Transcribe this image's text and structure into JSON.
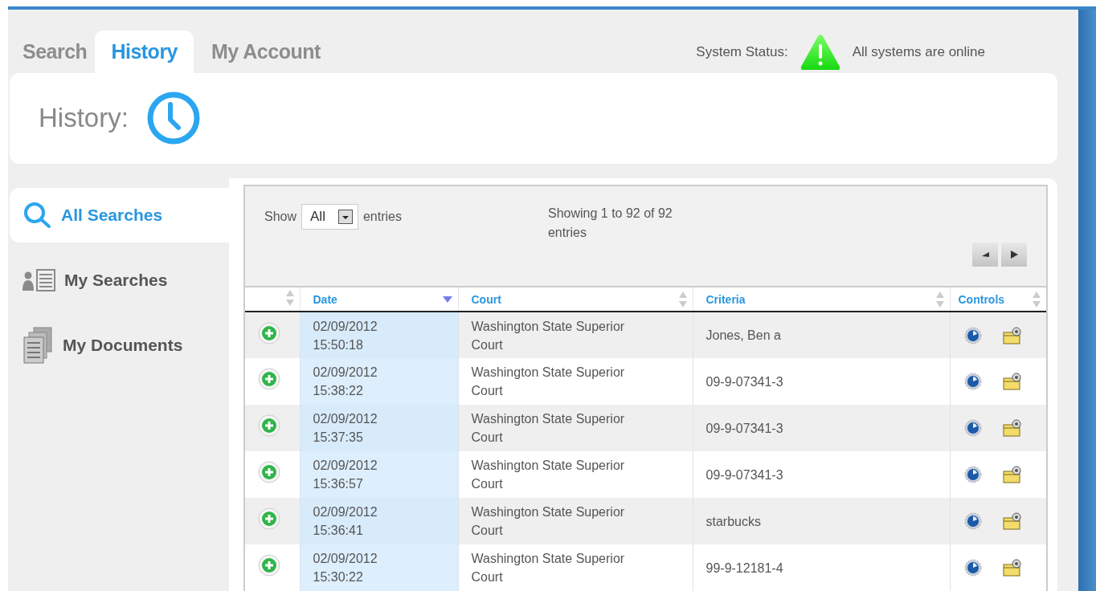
{
  "tabs": [
    {
      "label": "Search",
      "selected": false
    },
    {
      "label": "History",
      "selected": true
    },
    {
      "label": "My Account",
      "selected": false
    }
  ],
  "system_status": {
    "label": "System Status:",
    "message": "All systems are online"
  },
  "page_title": "History:",
  "sidebar": {
    "items": [
      {
        "label": "All Searches",
        "kind": "search",
        "selected": true
      },
      {
        "label": "My Searches",
        "kind": "list",
        "selected": false
      },
      {
        "label": "My Documents",
        "kind": "documents",
        "selected": false
      }
    ]
  },
  "table_toolbar": {
    "show_label": "Show",
    "page_size": "All",
    "entries_label": "entries",
    "info": "Showing 1 to 92 of 92 entries"
  },
  "table": {
    "columns": [
      {
        "label": "Date",
        "sorted": true
      },
      {
        "label": "Court",
        "sorted": false
      },
      {
        "label": "Criteria",
        "sorted": false
      },
      {
        "label": "Controls",
        "sorted": false
      }
    ],
    "rows": [
      {
        "date": "02/09/2012 15:50:18",
        "court": "Washington State Superior Court",
        "criteria": "Jones, Ben a"
      },
      {
        "date": "02/09/2012 15:38:22",
        "court": "Washington State Superior Court",
        "criteria": "09-9-07341-3"
      },
      {
        "date": "02/09/2012 15:37:35",
        "court": "Washington State Superior Court",
        "criteria": "09-9-07341-3"
      },
      {
        "date": "02/09/2012 15:36:57",
        "court": "Washington State Superior Court",
        "criteria": "09-9-07341-3"
      },
      {
        "date": "02/09/2012 15:36:41",
        "court": "Washington State Superior Court",
        "criteria": "starbucks"
      },
      {
        "date": "02/09/2012 15:30:22",
        "court": "Washington State Superior Court",
        "criteria": "99-9-12181-4"
      }
    ]
  }
}
